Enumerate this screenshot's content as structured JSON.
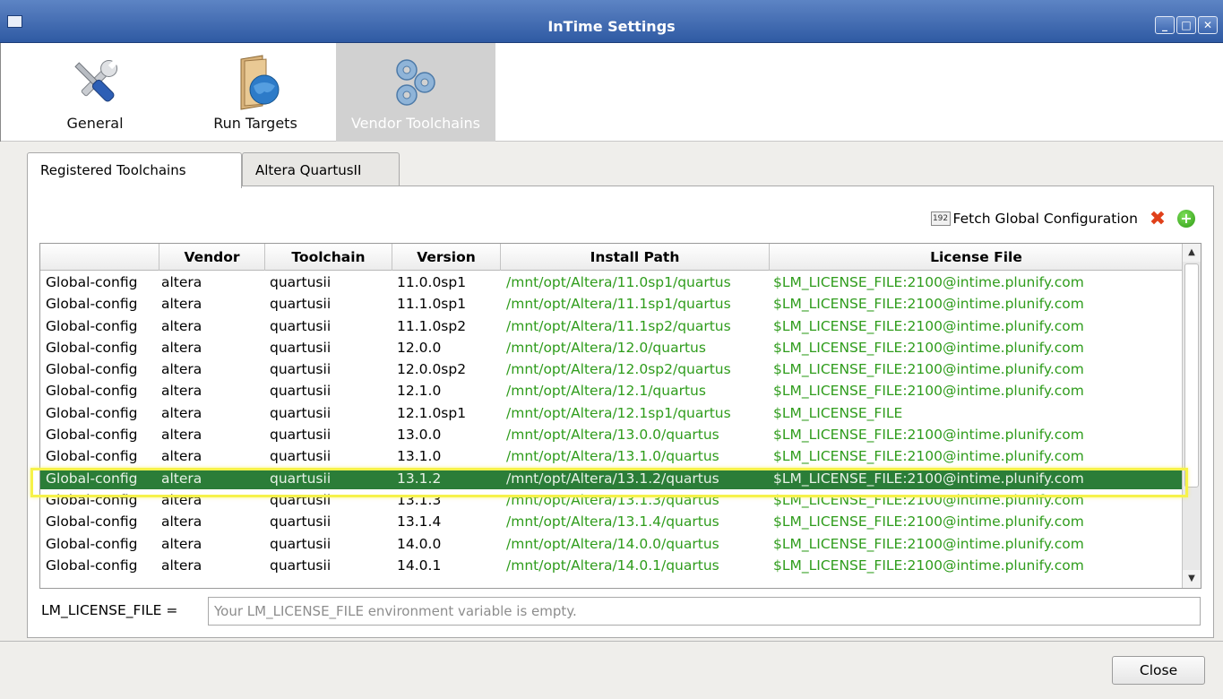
{
  "window": {
    "title": "InTime Settings"
  },
  "toolbar": {
    "items": [
      {
        "label": "General",
        "icon": "wrench-screwdriver-icon",
        "active": false
      },
      {
        "label": "Run Targets",
        "icon": "folder-globe-icon",
        "active": false
      },
      {
        "label": "Vendor Toolchains",
        "icon": "gears-icon",
        "active": true
      }
    ]
  },
  "tabs": [
    {
      "label": "Registered Toolchains",
      "active": true
    },
    {
      "label": "Altera QuartusII",
      "active": false
    }
  ],
  "actions": {
    "fetch_label": "Fetch Global Configuration",
    "fetch_icon_text": "192"
  },
  "table": {
    "columns": [
      "",
      "Vendor",
      "Toolchain",
      "Version",
      "Install Path",
      "License File"
    ],
    "rows": [
      [
        "Global-config",
        "altera",
        "quartusii",
        "11.0.0sp1",
        "/mnt/opt/Altera/11.0sp1/quartus",
        "$LM_LICENSE_FILE:2100@intime.plunify.com"
      ],
      [
        "Global-config",
        "altera",
        "quartusii",
        "11.1.0sp1",
        "/mnt/opt/Altera/11.1sp1/quartus",
        "$LM_LICENSE_FILE:2100@intime.plunify.com"
      ],
      [
        "Global-config",
        "altera",
        "quartusii",
        "11.1.0sp2",
        "/mnt/opt/Altera/11.1sp2/quartus",
        "$LM_LICENSE_FILE:2100@intime.plunify.com"
      ],
      [
        "Global-config",
        "altera",
        "quartusii",
        "12.0.0",
        "/mnt/opt/Altera/12.0/quartus",
        "$LM_LICENSE_FILE:2100@intime.plunify.com"
      ],
      [
        "Global-config",
        "altera",
        "quartusii",
        "12.0.0sp2",
        "/mnt/opt/Altera/12.0sp2/quartus",
        "$LM_LICENSE_FILE:2100@intime.plunify.com"
      ],
      [
        "Global-config",
        "altera",
        "quartusii",
        "12.1.0",
        "/mnt/opt/Altera/12.1/quartus",
        "$LM_LICENSE_FILE:2100@intime.plunify.com"
      ],
      [
        "Global-config",
        "altera",
        "quartusii",
        "12.1.0sp1",
        "/mnt/opt/Altera/12.1sp1/quartus",
        "$LM_LICENSE_FILE"
      ],
      [
        "Global-config",
        "altera",
        "quartusii",
        "13.0.0",
        "/mnt/opt/Altera/13.0.0/quartus",
        "$LM_LICENSE_FILE:2100@intime.plunify.com"
      ],
      [
        "Global-config",
        "altera",
        "quartusii",
        "13.1.0",
        "/mnt/opt/Altera/13.1.0/quartus",
        "$LM_LICENSE_FILE:2100@intime.plunify.com"
      ],
      [
        "Global-config",
        "altera",
        "quartusii",
        "13.1.2",
        "/mnt/opt/Altera/13.1.2/quartus",
        "$LM_LICENSE_FILE:2100@intime.plunify.com"
      ],
      [
        "Global-config",
        "altera",
        "quartusii",
        "13.1.3",
        "/mnt/opt/Altera/13.1.3/quartus",
        "$LM_LICENSE_FILE:2100@intime.plunify.com"
      ],
      [
        "Global-config",
        "altera",
        "quartusii",
        "13.1.4",
        "/mnt/opt/Altera/13.1.4/quartus",
        "$LM_LICENSE_FILE:2100@intime.plunify.com"
      ],
      [
        "Global-config",
        "altera",
        "quartusii",
        "14.0.0",
        "/mnt/opt/Altera/14.0.0/quartus",
        "$LM_LICENSE_FILE:2100@intime.plunify.com"
      ],
      [
        "Global-config",
        "altera",
        "quartusii",
        "14.0.1",
        "/mnt/opt/Altera/14.0.1/quartus",
        "$LM_LICENSE_FILE:2100@intime.plunify.com"
      ]
    ],
    "selected_row": 9
  },
  "license": {
    "label": "LM_LICENSE_FILE =",
    "value": "",
    "placeholder": "Your LM_LICENSE_FILE environment variable is empty."
  },
  "footer": {
    "close_label": "Close"
  },
  "colors": {
    "titlebar": "#3b64ab",
    "path_text": "#2f9c1c",
    "selection": "#2b7d38",
    "highlight": "#f6f24a"
  }
}
